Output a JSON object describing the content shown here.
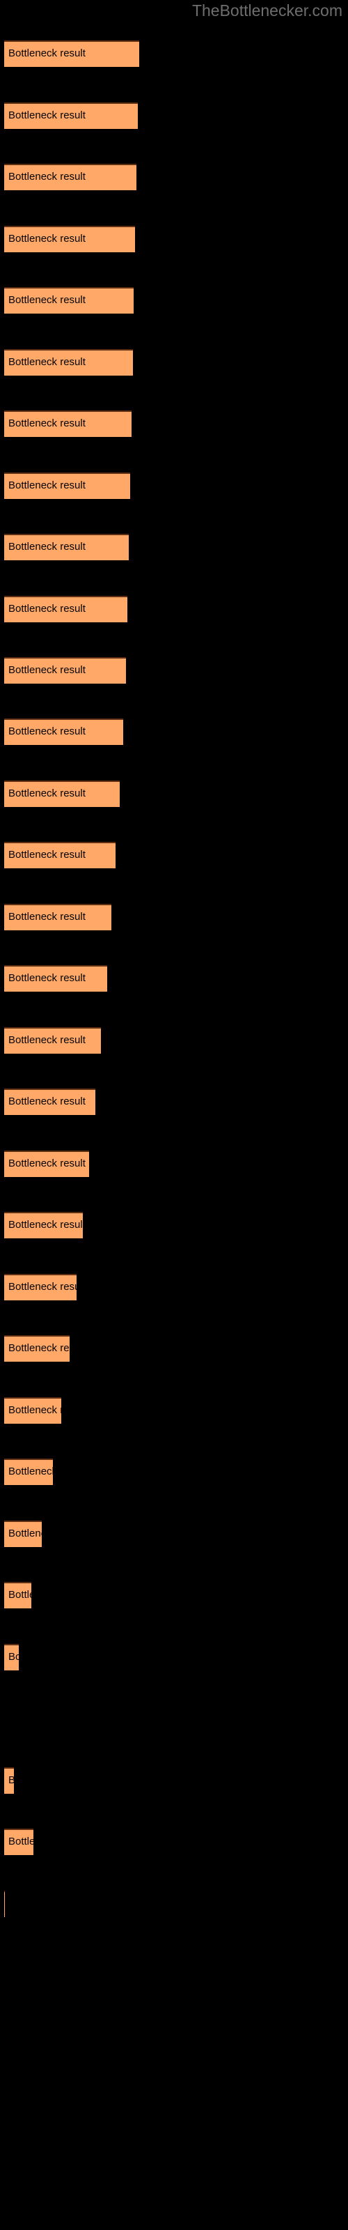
{
  "watermark": "TheBottlenecker.com",
  "colors": {
    "background": "#000000",
    "bar_fill": "#ffa868",
    "bar_border_top": "#5e2f12",
    "bar_label_text": "#050505",
    "watermark_text": "#6e6e6e"
  },
  "bar_label_text": "Bottleneck result",
  "chart_data": {
    "type": "bar",
    "orientation": "horizontal",
    "title": "",
    "subtitle": "",
    "xlabel": "",
    "ylabel": "",
    "grid": false,
    "legend": null,
    "annotations": [
      "TheBottlenecker.com"
    ],
    "bar_label": "Bottleneck result",
    "categories": [
      "Bottleneck result",
      "Bottleneck result",
      "Bottleneck result",
      "Bottleneck result",
      "Bottleneck result",
      "Bottleneck result",
      "Bottleneck result",
      "Bottleneck result",
      "Bottleneck result",
      "Bottleneck result",
      "Bottleneck result",
      "Bottleneck result",
      "Bottleneck result",
      "Bottleneck result",
      "Bottleneck result",
      "Bottleneck result",
      "Bottleneck result",
      "Bottleneck result",
      "Bottleneck result",
      "Bottleneck result",
      "Bottleneck result",
      "Bottleneck result",
      "Bottleneck result",
      "Bottleneck result",
      "Bottleneck result",
      "Bottleneck result",
      "Bottleneck result",
      "Bottleneck result",
      "Bottleneck result",
      "Bottleneck result",
      "Bottleneck result",
      "Bottleneck result",
      "Bottleneck result",
      "Bottleneck result"
    ],
    "values": [
      194,
      192,
      190,
      188,
      186,
      185,
      183,
      181,
      179,
      177,
      175,
      171,
      166,
      160,
      154,
      148,
      139,
      131,
      122,
      113,
      104,
      94,
      82,
      70,
      54,
      39,
      21,
      0,
      14,
      42,
      1
    ],
    "xlim": [
      0,
      494
    ],
    "units": "px",
    "bar_tops": [
      58,
      147,
      235,
      324,
      412,
      501,
      589,
      678,
      766,
      855,
      943,
      1031,
      1120,
      1208,
      1297,
      1385,
      1474,
      1562,
      1651,
      1739,
      1828,
      1916,
      2005,
      2093,
      2182,
      2270,
      2359,
      2447,
      2536,
      2624,
      2713
    ]
  },
  "bars": [
    {
      "top": 58,
      "width": 194,
      "label": "Bottleneck result"
    },
    {
      "top": 147,
      "width": 192,
      "label": "Bottleneck result"
    },
    {
      "top": 235,
      "width": 190,
      "label": "Bottleneck result"
    },
    {
      "top": 324,
      "width": 188,
      "label": "Bottleneck result"
    },
    {
      "top": 412,
      "width": 186,
      "label": "Bottleneck result"
    },
    {
      "top": 501,
      "width": 185,
      "label": "Bottleneck result"
    },
    {
      "top": 589,
      "width": 183,
      "label": "Bottleneck result"
    },
    {
      "top": 678,
      "width": 181,
      "label": "Bottleneck result"
    },
    {
      "top": 766,
      "width": 179,
      "label": "Bottleneck result"
    },
    {
      "top": 855,
      "width": 177,
      "label": "Bottleneck result"
    },
    {
      "top": 943,
      "width": 175,
      "label": "Bottleneck result"
    },
    {
      "top": 1031,
      "width": 171,
      "label": "Bottleneck result"
    },
    {
      "top": 1120,
      "width": 166,
      "label": "Bottleneck result"
    },
    {
      "top": 1208,
      "width": 160,
      "label": "Bottleneck result"
    },
    {
      "top": 1297,
      "width": 154,
      "label": "Bottleneck result"
    },
    {
      "top": 1385,
      "width": 148,
      "label": "Bottleneck result"
    },
    {
      "top": 1474,
      "width": 139,
      "label": "Bottleneck result"
    },
    {
      "top": 1562,
      "width": 131,
      "label": "Bottleneck result"
    },
    {
      "top": 1651,
      "width": 122,
      "label": "Bottleneck result"
    },
    {
      "top": 1739,
      "width": 113,
      "label": "Bottleneck result"
    },
    {
      "top": 1828,
      "width": 104,
      "label": "Bottleneck result"
    },
    {
      "top": 1916,
      "width": 94,
      "label": "Bottleneck result"
    },
    {
      "top": 2005,
      "width": 82,
      "label": "Bottleneck result"
    },
    {
      "top": 2093,
      "width": 70,
      "label": "Bottleneck result"
    },
    {
      "top": 2182,
      "width": 54,
      "label": "Bottleneck result"
    },
    {
      "top": 2270,
      "width": 39,
      "label": "Bottleneck result"
    },
    {
      "top": 2359,
      "width": 21,
      "label": "Bottleneck result"
    },
    {
      "top": 2447,
      "width": 0,
      "label": "Bottleneck result"
    },
    {
      "top": 2536,
      "width": 14,
      "label": "Bottleneck result"
    },
    {
      "top": 2624,
      "width": 42,
      "label": "Bottleneck result"
    },
    {
      "top": 2713,
      "width": 1,
      "label": "Bottleneck result"
    }
  ]
}
